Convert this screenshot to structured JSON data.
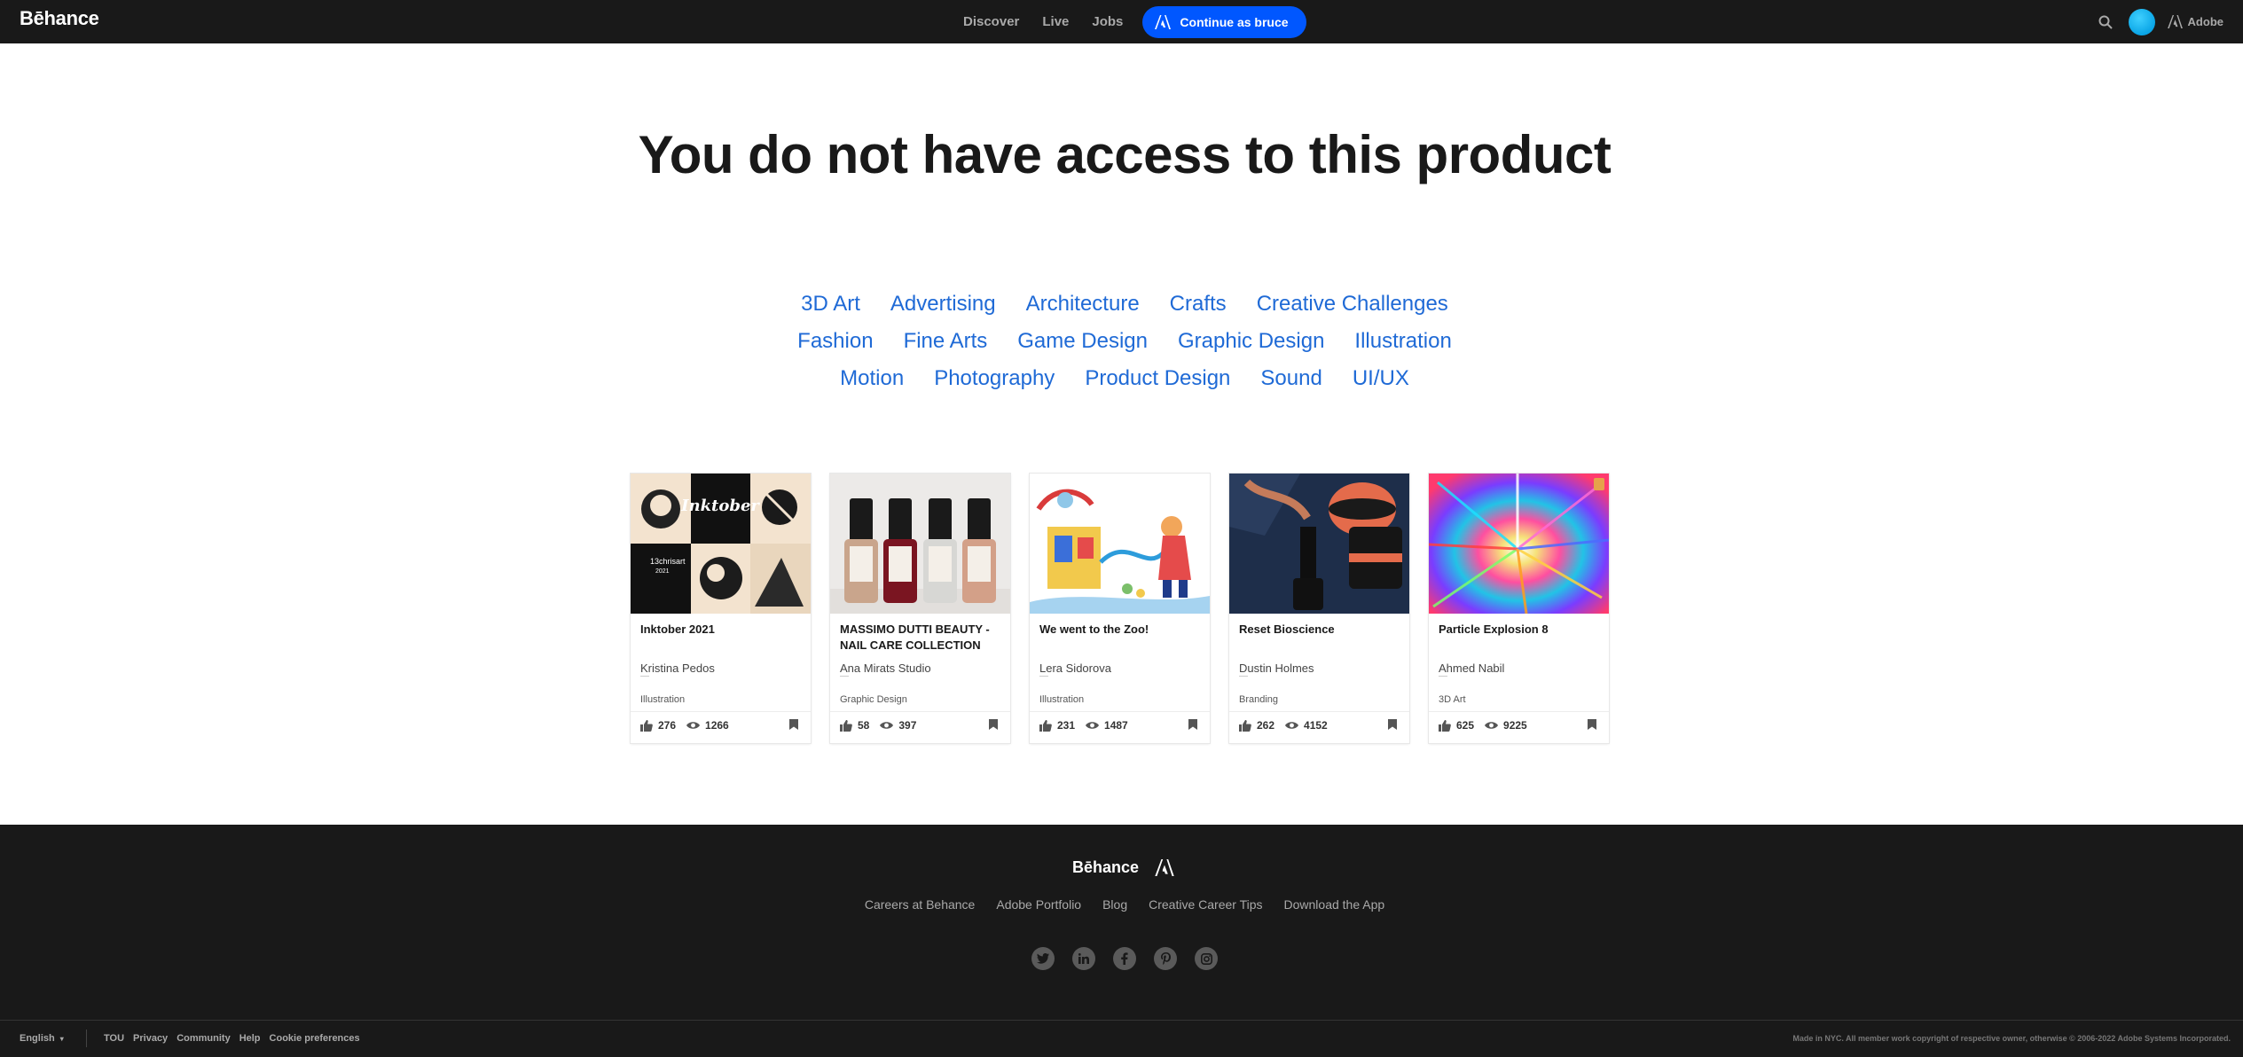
{
  "header": {
    "logo": "Bēhance",
    "nav": [
      "Discover",
      "Live",
      "Jobs"
    ],
    "cta_label": "Continue as bruce",
    "adobe_label": "Adobe"
  },
  "main": {
    "headline": "You do not have access to this product",
    "category_rows": [
      [
        "3D Art",
        "Advertising",
        "Architecture",
        "Crafts",
        "Creative Challenges"
      ],
      [
        "Fashion",
        "Fine Arts",
        "Game Design",
        "Graphic Design",
        "Illustration"
      ],
      [
        "Motion",
        "Photography",
        "Product Design",
        "Sound",
        "UI/UX"
      ]
    ],
    "cards": [
      {
        "title": "Inktober 2021",
        "owner": "Kristina Pedos",
        "field": "Illustration",
        "appreciations": "276",
        "views": "1266"
      },
      {
        "title": "MASSIMO DUTTI BEAUTY - NAIL CARE COLLECTION",
        "owner": "Ana Mirats Studio",
        "field": "Graphic Design",
        "appreciations": "58",
        "views": "397"
      },
      {
        "title": "We went to the Zoo!",
        "owner": "Lera Sidorova",
        "field": "Illustration",
        "appreciations": "231",
        "views": "1487"
      },
      {
        "title": "Reset Bioscience",
        "owner": "Dustin Holmes",
        "field": "Branding",
        "appreciations": "262",
        "views": "4152"
      },
      {
        "title": "Particle Explosion 8",
        "owner": "Ahmed Nabil",
        "field": "3D Art",
        "appreciations": "625",
        "views": "9225"
      }
    ]
  },
  "footer": {
    "logo": "Bēhance",
    "links": [
      "Careers at Behance",
      "Adobe Portfolio",
      "Blog",
      "Creative Career Tips",
      "Download the App"
    ],
    "socials": [
      "twitter-icon",
      "linkedin-icon",
      "facebook-icon",
      "pinterest-icon",
      "instagram-icon"
    ],
    "language": "English",
    "legal": [
      "TOU",
      "Privacy",
      "Community",
      "Help",
      "Cookie preferences"
    ],
    "copyright": "Made in NYC. All member work copyright of respective owner, otherwise © 2006-2022 Adobe Systems Incorporated."
  },
  "colors": {
    "accent": "#0057ff",
    "category_link": "#1f6ad6",
    "dark": "#191919"
  }
}
